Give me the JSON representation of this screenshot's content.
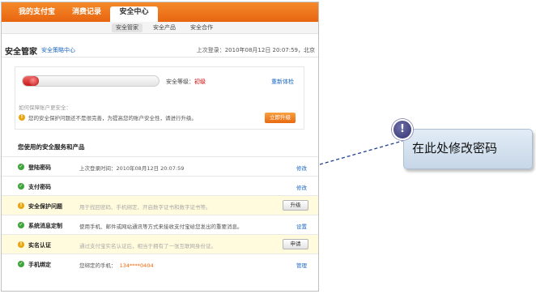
{
  "topnav": {
    "tabs": [
      {
        "label": "我的支付宝"
      },
      {
        "label": "消费记录"
      },
      {
        "label": "安全中心"
      }
    ]
  },
  "subnav": {
    "tabs": [
      {
        "label": "安全管家"
      },
      {
        "label": "安全产品"
      },
      {
        "label": "安全合作"
      }
    ]
  },
  "header": {
    "title": "安全管家",
    "center_link": "安全策略中心",
    "last_login": "上次登录：2010年08月12日  20:07:59，北京"
  },
  "status": {
    "level_prefix": "安全等级：",
    "level_value": "初级",
    "level_fraction": 0.06,
    "recheck_label": "重新体检",
    "account_question": "如何保障账户更安全：",
    "warning_text": "您的安全保护问题还不是很完善，为提高您的账户安全性，请进行升级。",
    "upgrade_button": "立即升级"
  },
  "services": {
    "section_title": "您使用的安全服务和产品",
    "rows": [
      {
        "name": "登陆密码",
        "desc": "上次登录时间：2010年08月12日  20:07:59",
        "action": "修改",
        "icon": "check-icon",
        "highlight": false
      },
      {
        "name": "支付密码",
        "desc": "",
        "action": "修改",
        "icon": "check-icon",
        "highlight": false
      },
      {
        "name": "安全保护问题",
        "desc": "用于找回密码、手机绑定、开启数字证书和数字证书等。",
        "button": "升级",
        "icon": "warning-icon",
        "highlight": true
      },
      {
        "name": "系统消息定制",
        "desc": "使用手机、邮件或网站通讯等方式来接收支付宝给您发出的重要消息。",
        "action": "设置",
        "icon": "check-icon",
        "highlight": false
      },
      {
        "name": "实名认证",
        "desc": "通过支付宝实名认证后，相当于拥有了一张互联网身份证。",
        "button": "申请",
        "icon": "warning-icon",
        "highlight": true
      },
      {
        "name": "手机绑定",
        "desc": "您绑定的手机：",
        "phone": "134****0404",
        "action": "管理",
        "icon": "check-icon",
        "highlight": false
      }
    ]
  },
  "callout": {
    "badge": "!",
    "text": "在此处修改密码"
  },
  "colors": {
    "nav_orange": "#e86510",
    "link_blue": "#1a66c2",
    "ok_green": "#3fa43a",
    "warn_amber": "#e9a50f",
    "level_red": "#d60000"
  }
}
